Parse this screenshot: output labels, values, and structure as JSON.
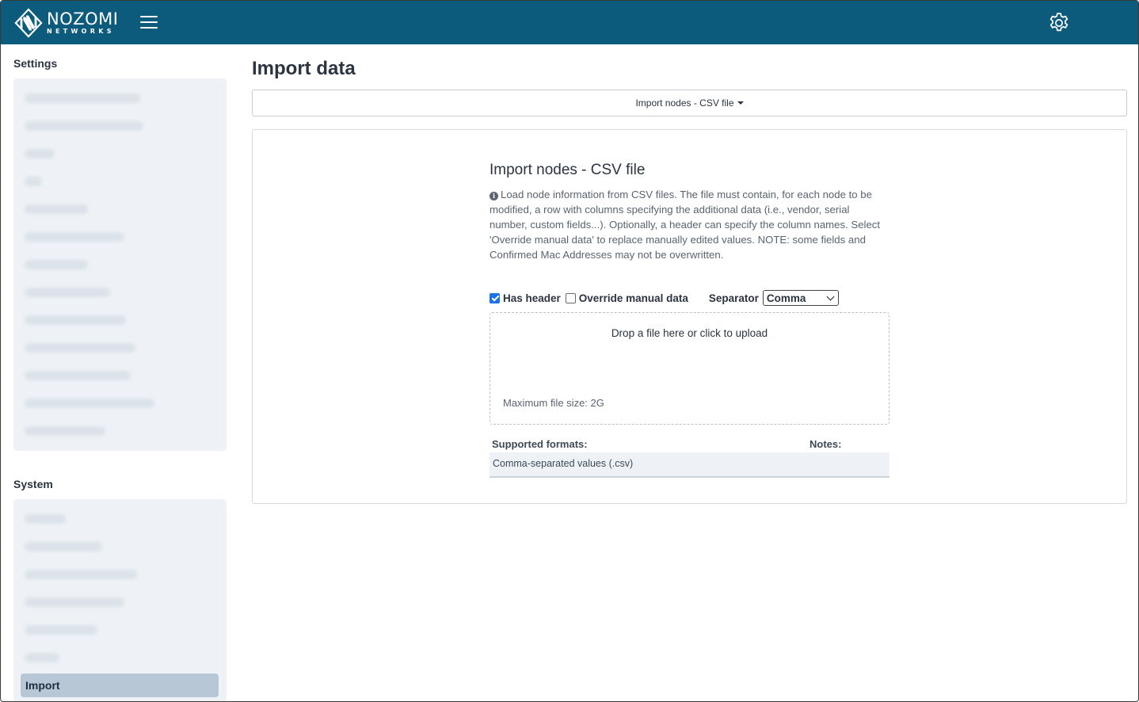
{
  "header": {
    "brand_name": "NOZOMI",
    "brand_sub": "NETWORKS",
    "brand_color": "#0d5b7c"
  },
  "sidebar": {
    "settings_heading": "Settings",
    "system_heading": "System",
    "active_item": "Import"
  },
  "main": {
    "page_title": "Import data",
    "import_type_selected": "Import nodes - CSV file",
    "section_title": "Import nodes - CSV file",
    "description": "Load node information from CSV files. The file must contain, for each node to be modified, a row with columns specifying the additional data (i.e., vendor, serial number, custom fields...). Optionally, a header can specify the column names. Select 'Override manual data' to replace manually edited values. NOTE: some fields and Confirmed Mac Addresses may not be overwritten.",
    "has_header_label": "Has header",
    "has_header_checked": true,
    "override_label": "Override manual data",
    "override_checked": false,
    "separator_label": "Separator",
    "separator_value": "Comma",
    "dropzone_text": "Drop a file here or click to upload",
    "max_file_size": "Maximum file size: 2G",
    "supported_formats_heading": "Supported formats:",
    "notes_heading": "Notes:",
    "formats": [
      "Comma-separated values (.csv)"
    ]
  }
}
